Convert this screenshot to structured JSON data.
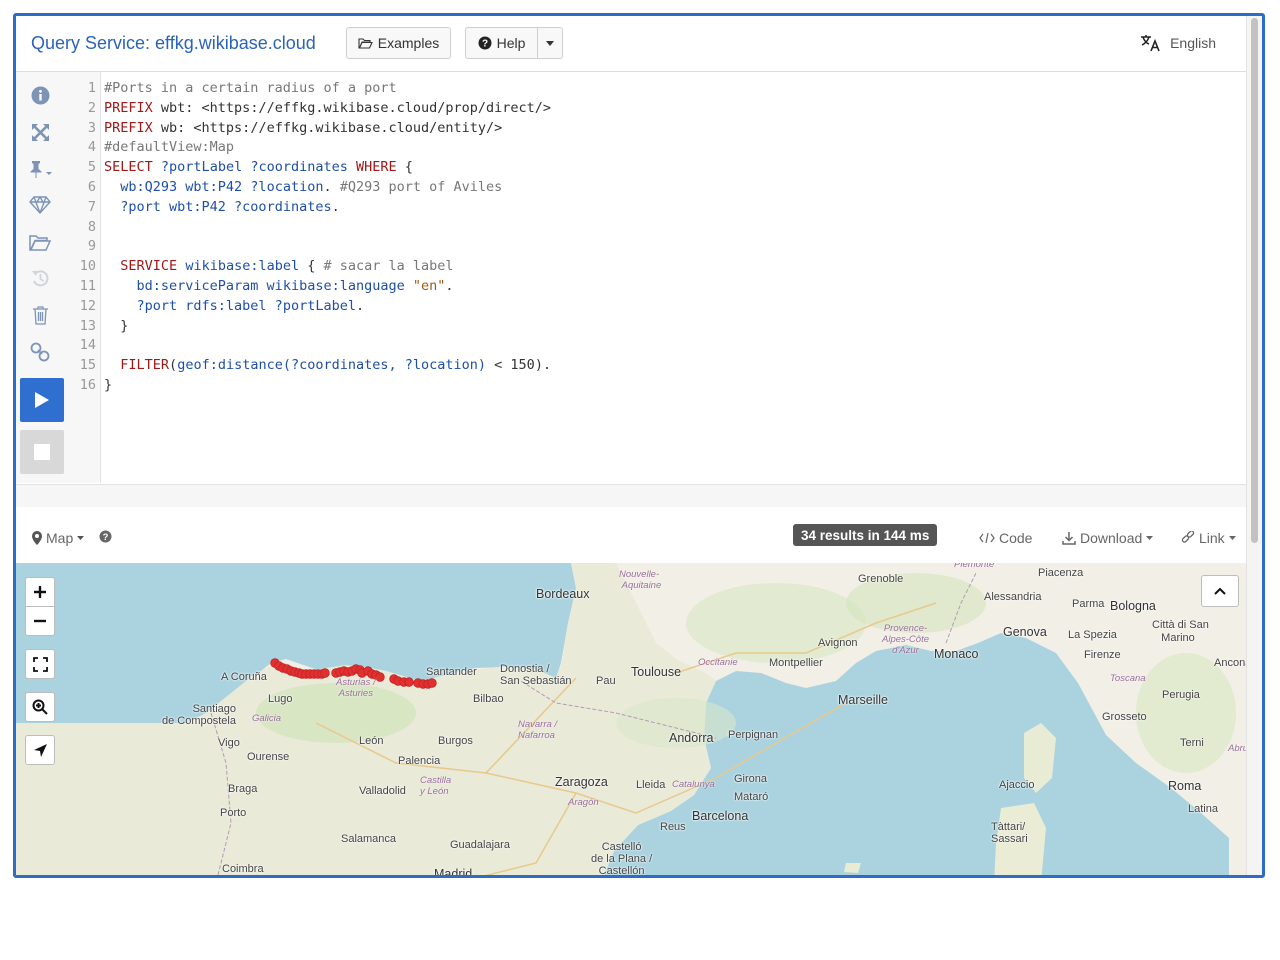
{
  "header": {
    "title": "Query Service: effkg.wikibase.cloud",
    "examples_label": "Examples",
    "help_label": "Help",
    "language_label": "English"
  },
  "editor": {
    "line_numbers": [
      "1",
      "2",
      "3",
      "4",
      "5",
      "6",
      "7",
      "8",
      "9",
      "10",
      "11",
      "12",
      "13",
      "14",
      "15",
      "16"
    ],
    "lines": [
      {
        "n": 1,
        "tokens": [
          {
            "c": "cm",
            "t": "#Ports in a certain radius of a port"
          }
        ]
      },
      {
        "n": 2,
        "tokens": [
          {
            "c": "kw",
            "t": "PREFIX"
          },
          {
            "c": "ur",
            "t": " wbt: <https://effkg.wikibase.cloud/prop/direct/>"
          }
        ]
      },
      {
        "n": 3,
        "tokens": [
          {
            "c": "kw",
            "t": "PREFIX"
          },
          {
            "c": "ur",
            "t": " wb: <https://effkg.wikibase.cloud/entity/>"
          }
        ]
      },
      {
        "n": 4,
        "tokens": [
          {
            "c": "cm",
            "t": "#defaultView:Map"
          }
        ]
      },
      {
        "n": 5,
        "tokens": [
          {
            "c": "kw",
            "t": "SELECT"
          },
          {
            "c": "ur",
            "t": " "
          },
          {
            "c": "vr",
            "t": "?portLabel ?coordinates"
          },
          {
            "c": "ur",
            "t": " "
          },
          {
            "c": "kw",
            "t": "WHERE"
          },
          {
            "c": "ur",
            "t": " {"
          }
        ]
      },
      {
        "n": 6,
        "tokens": [
          {
            "c": "ur",
            "t": "  "
          },
          {
            "c": "vr",
            "t": "wb:Q293 wbt:P42 ?location"
          },
          {
            "c": "ur",
            "t": ". "
          },
          {
            "c": "cm",
            "t": "#Q293 port of Aviles"
          }
        ]
      },
      {
        "n": 7,
        "tokens": [
          {
            "c": "ur",
            "t": "  "
          },
          {
            "c": "vr",
            "t": "?port wbt:P42 ?coordinates"
          },
          {
            "c": "ur",
            "t": "."
          }
        ]
      },
      {
        "n": 8,
        "tokens": []
      },
      {
        "n": 9,
        "tokens": []
      },
      {
        "n": 10,
        "tokens": [
          {
            "c": "ur",
            "t": "  "
          },
          {
            "c": "kw",
            "t": "SERVICE"
          },
          {
            "c": "ur",
            "t": " "
          },
          {
            "c": "vr",
            "t": "wikibase:label"
          },
          {
            "c": "ur",
            "t": " { "
          },
          {
            "c": "cm",
            "t": "# sacar la label"
          }
        ]
      },
      {
        "n": 11,
        "tokens": [
          {
            "c": "ur",
            "t": "    "
          },
          {
            "c": "vr",
            "t": "bd:serviceParam wikibase:language"
          },
          {
            "c": "ur",
            "t": " "
          },
          {
            "c": "st",
            "t": "\"en\""
          },
          {
            "c": "ur",
            "t": "."
          }
        ]
      },
      {
        "n": 12,
        "tokens": [
          {
            "c": "ur",
            "t": "    "
          },
          {
            "c": "vr",
            "t": "?port rdfs:label ?portLabel"
          },
          {
            "c": "ur",
            "t": "."
          }
        ]
      },
      {
        "n": 13,
        "tokens": [
          {
            "c": "ur",
            "t": "  }"
          }
        ]
      },
      {
        "n": 14,
        "tokens": []
      },
      {
        "n": 15,
        "tokens": [
          {
            "c": "ur",
            "t": "  "
          },
          {
            "c": "kw",
            "t": "FILTER"
          },
          {
            "c": "ur",
            "t": "("
          },
          {
            "c": "vr",
            "t": "geof:distance(?coordinates, ?location)"
          },
          {
            "c": "ur",
            "t": " < 150)."
          }
        ]
      },
      {
        "n": 16,
        "tokens": [
          {
            "c": "ur",
            "t": "}"
          }
        ]
      }
    ]
  },
  "results_bar": {
    "view_label": "Map",
    "results_badge": "34 results in 144 ms",
    "code_label": "Code",
    "download_label": "Download",
    "link_label": "Link"
  },
  "map": {
    "cities": [
      "Bordeaux",
      "Toulouse",
      "Montpellier",
      "Marseille",
      "Avignon",
      "Monaco",
      "Genova",
      "Grenoble",
      "Alessandria",
      "Piacenza",
      "Parma",
      "Bologna",
      "Città di San Marino",
      "Firenze",
      "La Spezia",
      "Ancona",
      "Perugia",
      "Grosseto",
      "Terni",
      "Roma",
      "Latina",
      "Ajaccio",
      "Tàttari/Sassari",
      "Andorra",
      "Perpignan",
      "Girona",
      "Mataró",
      "Barcelona",
      "Lleida",
      "Reus",
      "Zaragoza",
      "Castelló de la Plana / Castellón",
      "Guadalajara",
      "Madrid",
      "Salamanca",
      "Valladolid",
      "Palencia",
      "Burgos",
      "León",
      "Bilbao",
      "Santander",
      "Donostia / San Sebastián",
      "Pau",
      "A Coruña",
      "Lugo",
      "Santiago de Compostela",
      "Vigo",
      "Ourense",
      "Braga",
      "Porto",
      "Coimbra",
      "Nouvelle-Aquitaine",
      "Occitanie",
      "Provence-Alpes-Côte d'Azur",
      "Asturias / Asturies",
      "Galicia",
      "Navarra / Nafarroa",
      "Castilla y León",
      "Aragón",
      "Catalunya",
      "Toscana",
      "Abruzzo",
      "Piemonte"
    ],
    "marker_color": "#e03030",
    "markers": 34
  }
}
